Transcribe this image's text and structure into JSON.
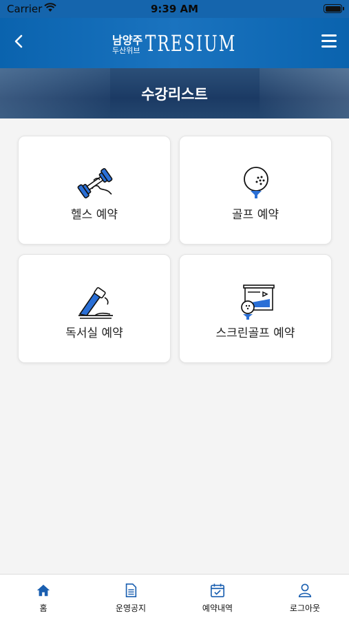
{
  "status_bar": {
    "carrier": "Carrier",
    "time": "9:39 AM"
  },
  "header": {
    "logo_ko_top": "남양주",
    "logo_ko_bottom": "두산위브",
    "logo_brand": "TRESIUM",
    "page_title": "수강리스트"
  },
  "cards": [
    {
      "label": "헬스 예약",
      "icon": "dumbbell-icon"
    },
    {
      "label": "골프 예약",
      "icon": "golf-ball-icon"
    },
    {
      "label": "독서실 예약",
      "icon": "reading-room-icon"
    },
    {
      "label": "스크린골프 예약",
      "icon": "screen-golf-icon"
    }
  ],
  "tabs": [
    {
      "label": "홈",
      "icon": "home-icon"
    },
    {
      "label": "운영공지",
      "icon": "notice-icon"
    },
    {
      "label": "예약내역",
      "icon": "calendar-check-icon"
    },
    {
      "label": "로그아웃",
      "icon": "user-icon"
    }
  ],
  "colors": {
    "accent": "#1565ad",
    "icon_blue": "#2a6fd6"
  }
}
